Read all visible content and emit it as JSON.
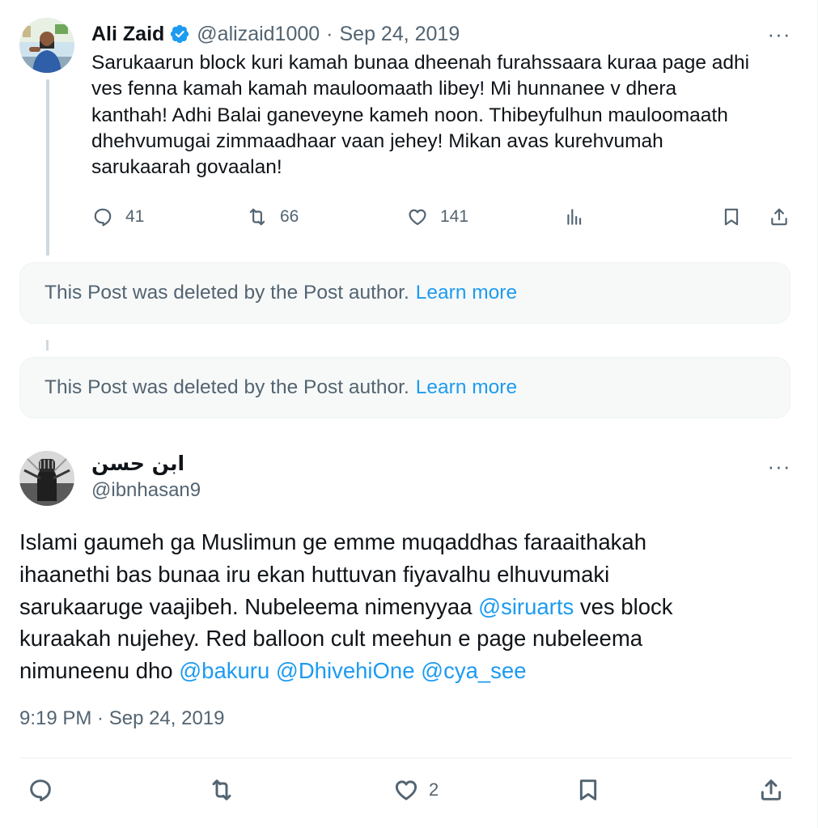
{
  "post1": {
    "author_name": "Ali Zaid",
    "verified": true,
    "handle": "@alizaid1000",
    "separator": "·",
    "date": "Sep 24, 2019",
    "more_label": "···",
    "text_lines": [
      "Sarukaarun block kuri kamah bunaa dheenah furahssaara kuraa page adhi",
      "ves fenna kamah kamah mauloomaath libey! Mi hunnanee v dhera",
      "kanthah! Adhi Balai ganeveyne kameh noon. Thibeyfulhun mauloomaath",
      "dhehvumugai zimmaadhaar vaan jehey! Mikan avas kurehvumah",
      "sarukaarah govaalan!"
    ],
    "actions": {
      "replies": "41",
      "reposts": "66",
      "likes": "141"
    }
  },
  "deleted_notices": [
    {
      "text": "This Post was deleted by the Post author.",
      "link": "Learn more"
    },
    {
      "text": "This Post was deleted by the Post author.",
      "link": "Learn more"
    }
  ],
  "post2": {
    "author_name": "ابن حسن",
    "handle": "@ibnhasan9",
    "more_label": "···",
    "text_line1": "Islami gaumeh ga Muslimun ge emme muqaddhas faraaithakah",
    "text_line2": "ihaanethi bas bunaa iru ekan huttuvan fiyavalhu elhuvumaki",
    "text_line3a": "sarukaaruge vaajibeh. Nubeleema nimenyyaa ",
    "mention1": "@siruarts",
    "text_line3b": " ves block",
    "text_line4": "kuraakah nujehey. Red balloon cult meehun e page nubeleema",
    "text_line5a": "nimuneenu dho ",
    "mention2": "@bakuru",
    "mention3": "@DhivehiOne",
    "mention4": "@cya_see",
    "timestamp": "9:19 PM · Sep 24, 2019",
    "actions": {
      "likes": "2"
    }
  },
  "colors": {
    "accent": "#1d9bf0",
    "text_primary": "#0f1419",
    "text_secondary": "#536471",
    "card_bg": "#f7f9f9"
  },
  "icons": [
    "verified-badge-icon",
    "more-icon",
    "reply-icon",
    "repost-icon",
    "like-icon",
    "views-icon",
    "bookmark-icon",
    "share-icon"
  ]
}
